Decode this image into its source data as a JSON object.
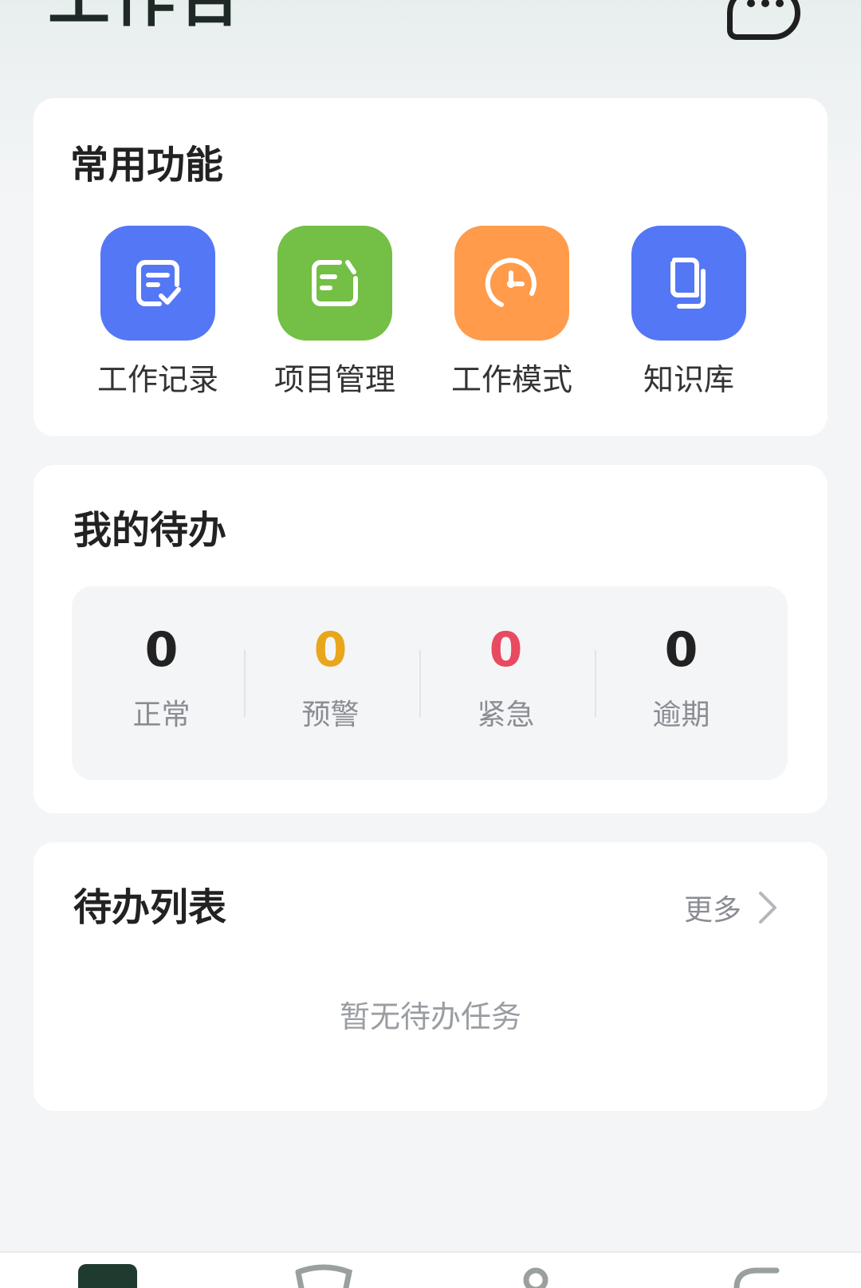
{
  "header": {
    "title": "工作台",
    "chat_icon": "chat-bubble-icon"
  },
  "colors": {
    "blue": "#5477f5",
    "green": "#74bf45",
    "orange": "#ff9b4a",
    "warning": "#e8a61b",
    "urgent": "#e84a5f",
    "text_dark": "#222222",
    "text_muted": "#8a8d93"
  },
  "functions": {
    "title": "常用功能",
    "items": [
      {
        "label": "工作记录",
        "icon": "work-record-icon",
        "color": "#5477f5"
      },
      {
        "label": "项目管理",
        "icon": "project-management-icon",
        "color": "#74bf45"
      },
      {
        "label": "工作模式",
        "icon": "clock-icon",
        "color": "#ff9b4a"
      },
      {
        "label": "知识库",
        "icon": "book-icon",
        "color": "#5477f5"
      }
    ]
  },
  "todos": {
    "title": "我的待办",
    "stats": [
      {
        "value": "0",
        "label": "正常",
        "color": "#222222"
      },
      {
        "value": "0",
        "label": "预警",
        "color": "#e8a61b"
      },
      {
        "value": "0",
        "label": "紧急",
        "color": "#e84a5f"
      },
      {
        "value": "0",
        "label": "逾期",
        "color": "#222222"
      }
    ]
  },
  "todo_list": {
    "title": "待办列表",
    "more_label": "更多",
    "empty_text": "暂无待办任务"
  },
  "bottom_nav": {
    "items": [
      {
        "icon": "workbench-tab-icon",
        "active": true
      },
      {
        "icon": "message-tab-icon",
        "active": false
      },
      {
        "icon": "contacts-tab-icon",
        "active": false
      },
      {
        "icon": "profile-tab-icon",
        "active": false
      }
    ]
  }
}
